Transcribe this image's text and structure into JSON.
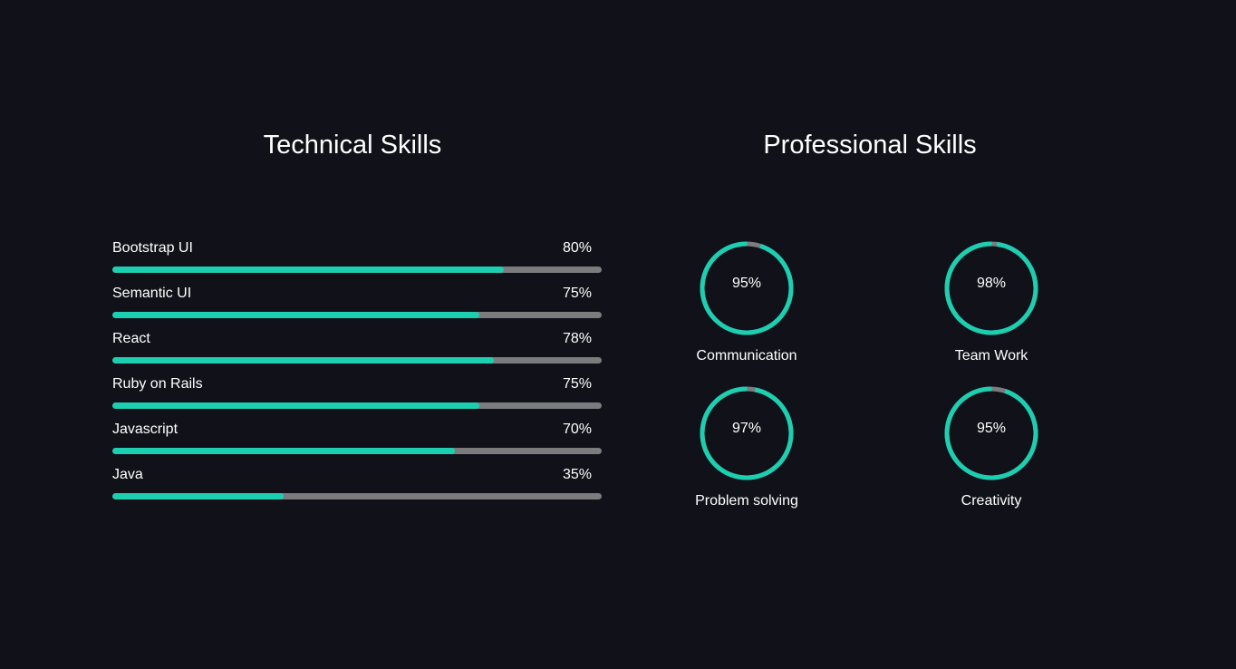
{
  "technical": {
    "title": "Technical Skills",
    "skills": [
      {
        "name": "Bootstrap UI",
        "percent_label": "80%",
        "level": 80
      },
      {
        "name": "Semantic UI",
        "percent_label": "75%",
        "level": 75
      },
      {
        "name": "React",
        "percent_label": "78%",
        "level": 78
      },
      {
        "name": "Ruby on Rails",
        "percent_label": "75%",
        "level": 75
      },
      {
        "name": "Javascript",
        "percent_label": "70%",
        "level": 70
      },
      {
        "name": "Java",
        "percent_label": "35%",
        "level": 35
      }
    ]
  },
  "professional": {
    "title": "Professional Skills",
    "skills": [
      {
        "name": "Communication",
        "percent_label": "95%",
        "level": 95
      },
      {
        "name": "Team Work",
        "percent_label": "98%",
        "level": 98
      },
      {
        "name": "Problem solving",
        "percent_label": "97%",
        "level": 97
      },
      {
        "name": "Creativity",
        "percent_label": "95%",
        "level": 95
      }
    ]
  },
  "colors": {
    "background": "#11111a",
    "accent": "#1ccfb0",
    "track": "#7c7c7f",
    "text": "#ffffff"
  }
}
